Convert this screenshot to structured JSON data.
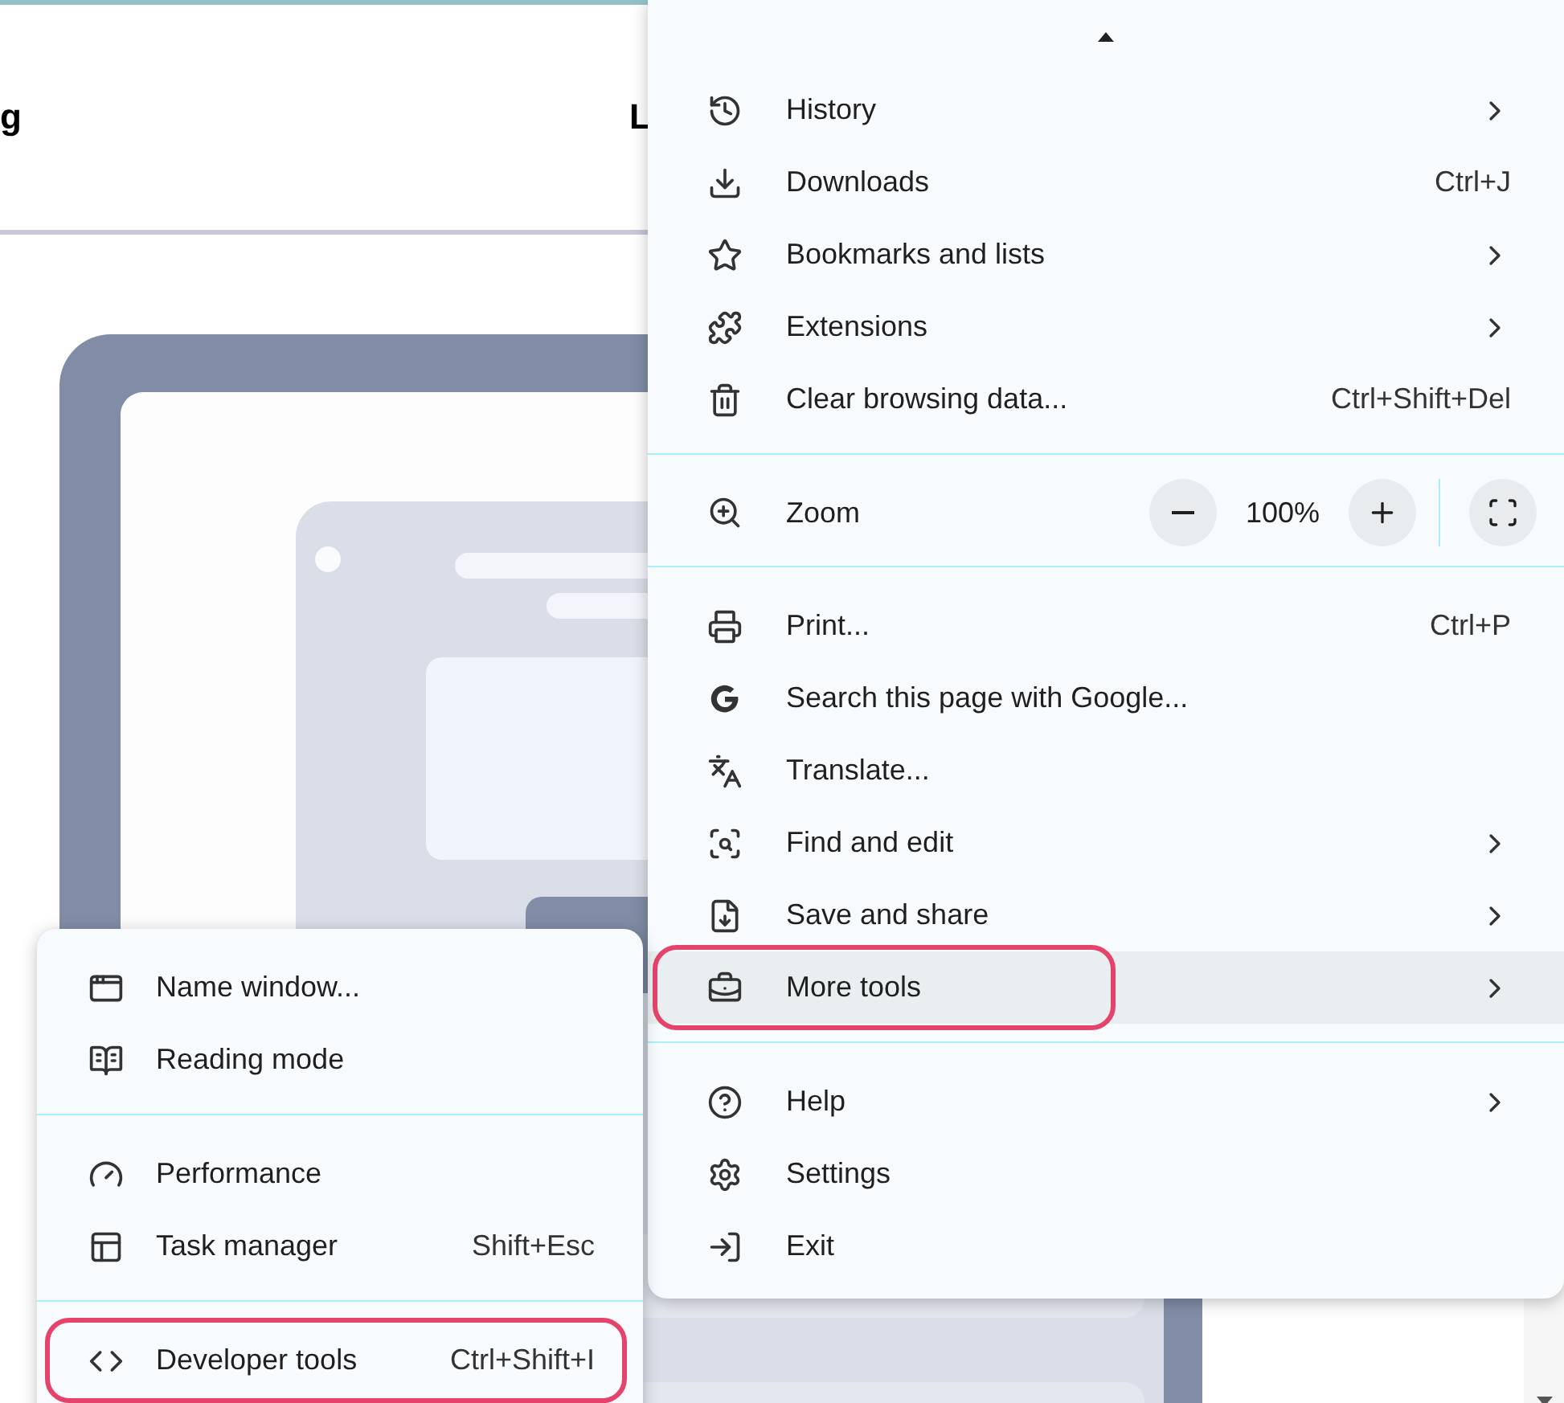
{
  "page": {
    "heading_fragments": [
      "g",
      "L"
    ]
  },
  "menu": {
    "sections": [
      {
        "items": [
          {
            "kind": "item",
            "label": "History",
            "submenu": true,
            "selected": false,
            "circled": false
          },
          {
            "kind": "item",
            "label": "Downloads",
            "shortcut": "Ctrl+J",
            "submenu": false,
            "selected": false,
            "circled": false
          },
          {
            "kind": "item",
            "label": "Bookmarks and lists",
            "submenu": true,
            "selected": false,
            "circled": false
          },
          {
            "kind": "item",
            "label": "Extensions",
            "submenu": true,
            "selected": false,
            "circled": false
          },
          {
            "kind": "item",
            "label": "Clear browsing data...",
            "shortcut": "Ctrl+Shift+Del",
            "submenu": false,
            "selected": false,
            "circled": false
          }
        ]
      },
      {
        "items": [
          {
            "kind": "zoom",
            "label": "Zoom",
            "value": "100%",
            "selected": false,
            "circled": false
          }
        ]
      },
      {
        "items": [
          {
            "kind": "item",
            "label": "Print...",
            "shortcut": "Ctrl+P",
            "submenu": false,
            "selected": false,
            "circled": false
          },
          {
            "kind": "item",
            "label": "Search this page with Google...",
            "submenu": false,
            "selected": false,
            "circled": false
          },
          {
            "kind": "item",
            "label": "Translate...",
            "submenu": false,
            "selected": false,
            "circled": false
          },
          {
            "kind": "item",
            "label": "Find and edit",
            "submenu": true,
            "selected": false,
            "circled": false
          },
          {
            "kind": "item",
            "label": "Save and share",
            "submenu": true,
            "selected": false,
            "circled": false
          },
          {
            "kind": "item",
            "label": "More tools",
            "submenu": true,
            "selected": true,
            "circled": true
          }
        ]
      },
      {
        "items": [
          {
            "kind": "item",
            "label": "Help",
            "submenu": true,
            "selected": false,
            "circled": false
          },
          {
            "kind": "item",
            "label": "Settings",
            "submenu": false,
            "selected": false,
            "circled": false
          },
          {
            "kind": "item",
            "label": "Exit",
            "submenu": false,
            "selected": false,
            "circled": false
          }
        ]
      }
    ]
  },
  "submenu": {
    "sections": [
      {
        "items": [
          {
            "kind": "item",
            "label": "Name window...",
            "submenu": false,
            "selected": false,
            "circled": false
          },
          {
            "kind": "item",
            "label": "Reading mode",
            "submenu": false,
            "selected": false,
            "circled": false
          }
        ]
      },
      {
        "items": [
          {
            "kind": "item",
            "label": "Performance",
            "submenu": false,
            "selected": false,
            "circled": false
          },
          {
            "kind": "item",
            "label": "Task manager",
            "shortcut": "Shift+Esc",
            "submenu": false,
            "selected": false,
            "circled": false
          }
        ]
      },
      {
        "items": [
          {
            "kind": "item",
            "label": "Developer tools",
            "shortcut": "Ctrl+Shift+I",
            "submenu": false,
            "selected": false,
            "circled": true
          }
        ]
      }
    ]
  }
}
